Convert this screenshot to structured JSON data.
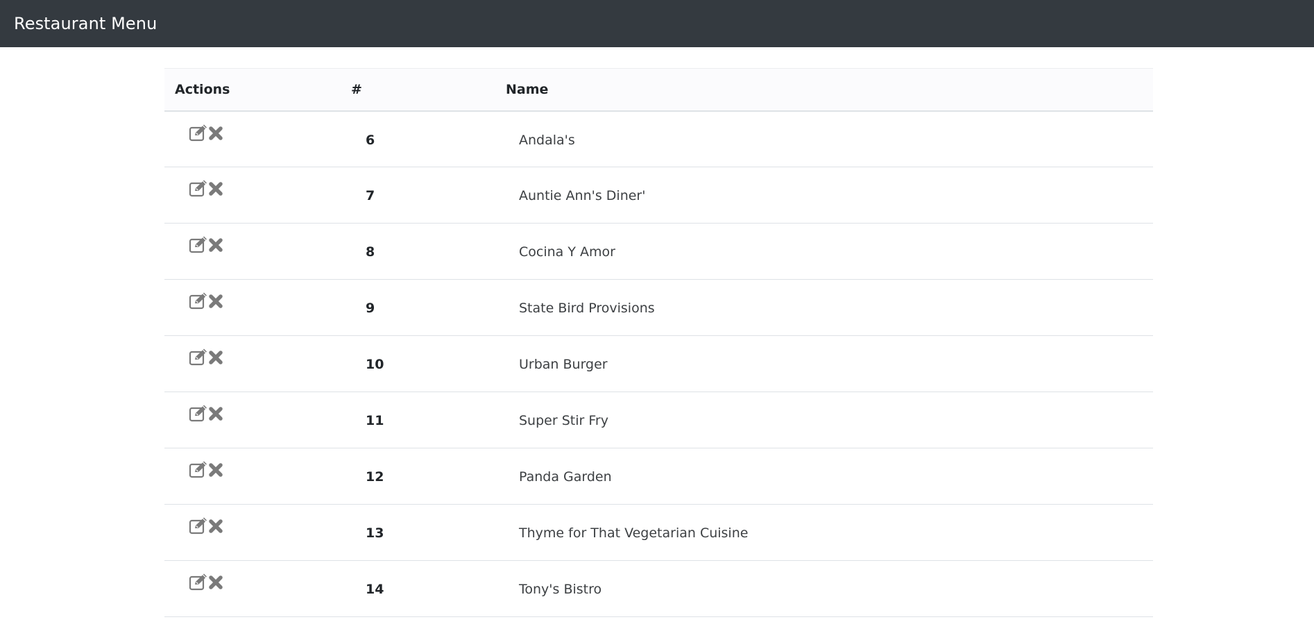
{
  "navbar": {
    "brand": "Restaurant Menu",
    "background_color": "#343a40"
  },
  "table": {
    "headers": {
      "actions": "Actions",
      "number": "#",
      "name": "Name"
    },
    "action_icons": [
      "edit-icon",
      "delete-icon"
    ],
    "rows": [
      {
        "id": "6",
        "name": "Andala's"
      },
      {
        "id": "7",
        "name": "Auntie Ann's Diner'"
      },
      {
        "id": "8",
        "name": "Cocina Y Amor"
      },
      {
        "id": "9",
        "name": "State Bird Provisions"
      },
      {
        "id": "10",
        "name": "Urban Burger"
      },
      {
        "id": "11",
        "name": "Super Stir Fry"
      },
      {
        "id": "12",
        "name": "Panda Garden"
      },
      {
        "id": "13",
        "name": "Thyme for That Vegetarian Cuisine"
      },
      {
        "id": "14",
        "name": "Tony's Bistro"
      }
    ]
  }
}
